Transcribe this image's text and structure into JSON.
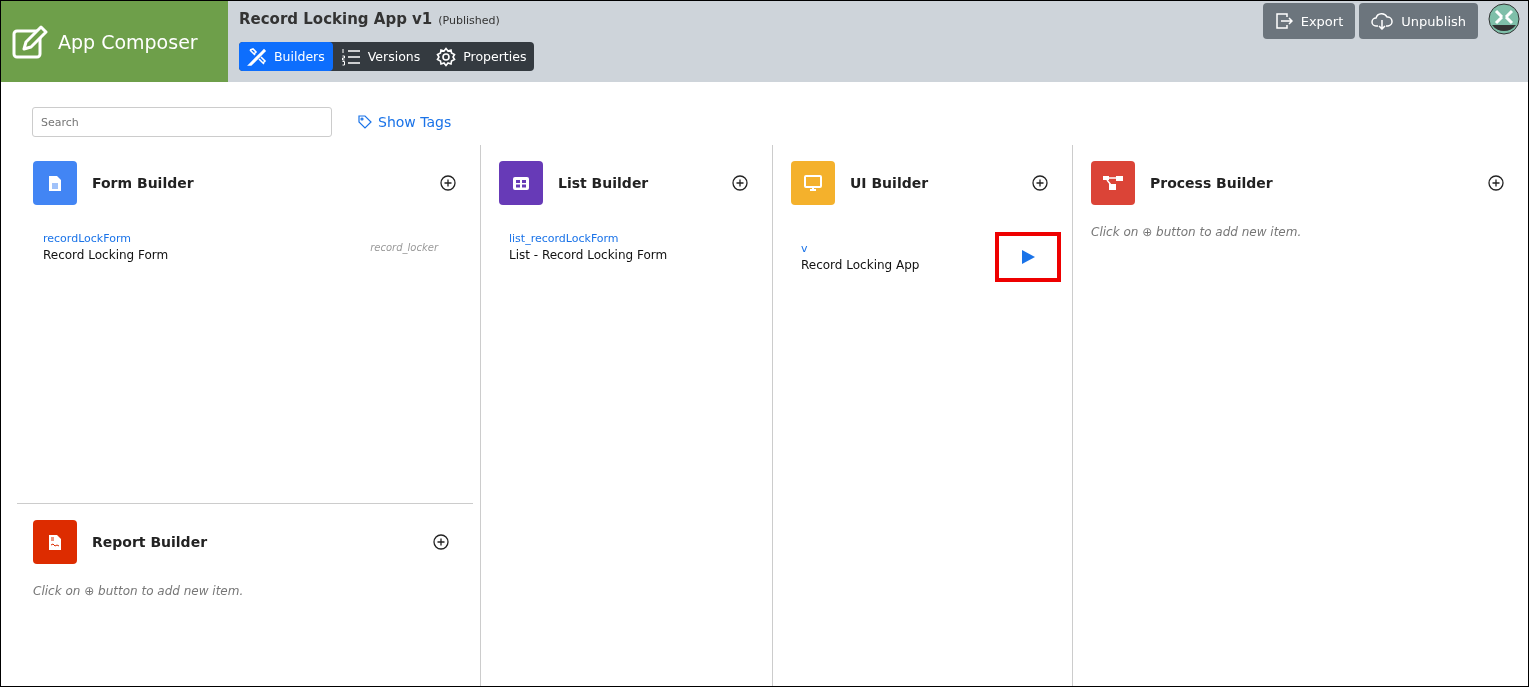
{
  "app": {
    "title": "App Composer"
  },
  "header": {
    "app_name": "Record Locking App v1",
    "status": "(Published)",
    "tabs": [
      {
        "label": "Builders",
        "selected": true,
        "kind": "builders"
      },
      {
        "label": "Versions",
        "selected": false,
        "kind": "versions"
      },
      {
        "label": "Properties",
        "selected": false,
        "kind": "properties"
      }
    ],
    "actions": [
      {
        "label": "Export",
        "kind": "export"
      },
      {
        "label": "Unpublish",
        "kind": "unpublish"
      }
    ]
  },
  "search": {
    "placeholder": "Search"
  },
  "show_tags": "Show Tags",
  "columns": [
    {
      "builders": [
        {
          "kind": "form",
          "title": "Form Builder",
          "color": "#4285f4",
          "items": [
            {
              "id": "recordLockForm",
              "name": "Record Locking Form",
              "tag": "record_locker"
            }
          ]
        },
        {
          "kind": "report",
          "title": "Report Builder",
          "color": "#dd2c00",
          "empty_hint": "Click on ⊕ button to add new item."
        }
      ]
    },
    {
      "builders": [
        {
          "kind": "list",
          "title": "List Builder",
          "color": "#673ab7",
          "items": [
            {
              "id": "list_recordLockForm",
              "name": "List - Record Locking Form"
            }
          ]
        }
      ]
    },
    {
      "builders": [
        {
          "kind": "ui",
          "title": "UI Builder",
          "color": "#f4b12c",
          "items": [
            {
              "id": "v",
              "name": "Record Locking App",
              "play_button": {
                "highlighted": true
              }
            }
          ]
        }
      ]
    },
    {
      "builders": [
        {
          "kind": "process",
          "title": "Process Builder",
          "color": "#db4437",
          "empty_hint": "Click on ⊕ button to add new item."
        }
      ]
    }
  ]
}
